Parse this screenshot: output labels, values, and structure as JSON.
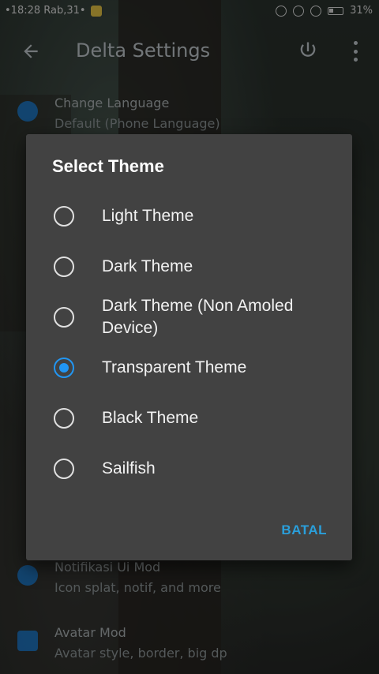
{
  "status_bar": {
    "left_text": "•18:28 Rab,31•",
    "battery_percent": "31%"
  },
  "app_bar": {
    "title": "Delta Settings"
  },
  "settings": [
    {
      "title": "Change Language",
      "subtitle": "Default (Phone Language)"
    },
    {
      "title": "Notifikasi Ui Mod",
      "subtitle": "Icon splat, notif, and more"
    },
    {
      "title": "Avatar Mod",
      "subtitle": "Avatar style, border, big dp"
    }
  ],
  "dialog": {
    "title": "Select Theme",
    "options": [
      {
        "label": "Light Theme",
        "selected": false
      },
      {
        "label": "Dark Theme",
        "selected": false
      },
      {
        "label": "Dark Theme (Non Amoled Device)",
        "selected": false
      },
      {
        "label": "Transparent Theme",
        "selected": true
      },
      {
        "label": "Black Theme",
        "selected": false
      },
      {
        "label": "Sailfish",
        "selected": false
      }
    ],
    "cancel_label": "BATAL"
  },
  "colors": {
    "accent": "#2196f3",
    "dialog_bg": "#424242"
  }
}
